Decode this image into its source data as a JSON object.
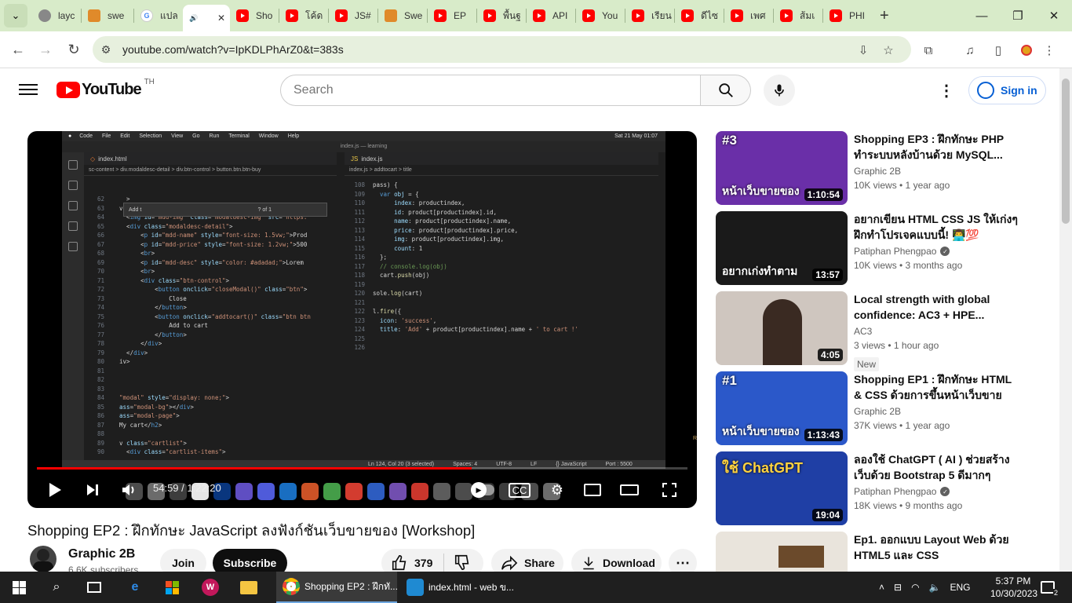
{
  "browser": {
    "tabs": [
      {
        "label": "layc",
        "icon": "globe-icon"
      },
      {
        "label": "swe",
        "icon": "swe-icon"
      },
      {
        "label": "แปล",
        "icon": "google-icon"
      },
      {
        "label": "",
        "icon": "audio-icon",
        "active": true
      },
      {
        "label": "Sho",
        "icon": "youtube-icon"
      },
      {
        "label": "โค้ด",
        "icon": "youtube-icon"
      },
      {
        "label": "JS#",
        "icon": "youtube-icon"
      },
      {
        "label": "Swe",
        "icon": "swe-icon"
      },
      {
        "label": "EP",
        "icon": "youtube-icon"
      },
      {
        "label": "พื้นฐ",
        "icon": "youtube-icon"
      },
      {
        "label": "API",
        "icon": "youtube-icon"
      },
      {
        "label": "You",
        "icon": "youtube-icon"
      },
      {
        "label": "เรียน",
        "icon": "youtube-icon"
      },
      {
        "label": "ดีไซ",
        "icon": "youtube-icon"
      },
      {
        "label": "เพศ",
        "icon": "youtube-icon"
      },
      {
        "label": "ส้มเ",
        "icon": "youtube-icon"
      },
      {
        "label": "PHI",
        "icon": "youtube-icon"
      }
    ],
    "url": "youtube.com/watch?v=IpKDLPhArZ0&t=383s"
  },
  "youtube": {
    "logo_text": "YouTube",
    "country_code": "TH",
    "search_placeholder": "Search",
    "signin_label": "Sign in"
  },
  "video": {
    "title": "Shopping EP2 : ฝึกทักษะ JavaScript ลงฟังก์ชันเว็บขายของ [Workshop]",
    "time_current": "54:59",
    "time_total": "1:22:20",
    "progress": 0.668,
    "channel_name": "Graphic 2B",
    "subscribers": "6.6K subscribers",
    "join_label": "Join",
    "subscribe_label": "Subscribe",
    "likes": "379",
    "share_label": "Share",
    "download_label": "Download"
  },
  "editor": {
    "title": "index.js — learning",
    "left_tab": "index.html",
    "right_tab": "index.js",
    "breadcrumb_left": "sc-content  >  div.modaldesc-detail  >  div.btn-control  >  button.btn.btn-buy",
    "breadcrumb_right": "index.js  >  addtocart  >  title",
    "find_text": "Add t",
    "find_result": "? of 1",
    "status": [
      "Ln 124, Col 20 (3 selected)",
      "Spaces: 4",
      "UTF-8",
      "LF",
      "{} JavaScript",
      "Port : 5500"
    ],
    "mac_menu": [
      "Code",
      "File",
      "Edit",
      "Selection",
      "View",
      "Go",
      "Run",
      "Terminal",
      "Window",
      "Help"
    ],
    "mac_clock": "Sat 21 May  01:07"
  },
  "recommendations": [
    {
      "title": "Shopping EP3 : ฝึกทักษะ PHP ทำระบบหลังบ้านด้วย MySQL...",
      "channel": "Graphic 2B",
      "verified": false,
      "meta": "10K views • 1 year ago",
      "duration": "1:10:54",
      "thumb_text": "หน้าเว็บขายของ",
      "thumb_tag": "#3",
      "thumb_color": "#6a2fa8"
    },
    {
      "title": "อยากเขียน HTML CSS JS ให้เก่งๆ ฝึกทำโปรเจคแบบนี้! 👨‍💻💯",
      "channel": "Patiphan Phengpao",
      "verified": true,
      "meta": "10K views • 3 months ago",
      "duration": "13:57",
      "thumb_text": "อยากเก่งทำตาม",
      "thumb_tag": "",
      "thumb_color": "#1a1a1a"
    },
    {
      "title": "Local strength with global confidence: AC3 + HPE...",
      "channel": "AC3",
      "verified": false,
      "meta": "3 views • 1 hour ago",
      "duration": "4:05",
      "badge": "New",
      "thumb_text": "",
      "thumb_tag": "",
      "thumb_color": "#cfc6bf"
    },
    {
      "title": "Shopping EP1 : ฝึกทักษะ HTML & CSS ด้วยการขึ้นหน้าเว็บขายขอ...",
      "channel": "Graphic 2B",
      "verified": false,
      "meta": "37K views • 1 year ago",
      "duration": "1:13:43",
      "thumb_text": "หน้าเว็บขายของ",
      "thumb_tag": "#1",
      "thumb_color": "#2b58c9"
    },
    {
      "title": "ลองใช้ ChatGPT ( AI ) ช่วยสร้างเว็บด้วย Bootstrap 5 ดีมากๆ งาน...",
      "channel": "Patiphan Phengpao",
      "verified": true,
      "meta": "18K views • 9 months ago",
      "duration": "19:04",
      "thumb_text": "ใช้ ChatGPT",
      "thumb_tag": "",
      "thumb_color": "#1f3fa5"
    },
    {
      "title": "Ep1. ออกแบบ Layout Web ด้วย HTML5 และ CSS",
      "channel": "",
      "verified": false,
      "meta": "",
      "duration": "",
      "thumb_text": "",
      "thumb_tag": "",
      "thumb_color": "#e9e4dc"
    }
  ],
  "taskbar": {
    "apps": [
      {
        "label": "Shopping EP2 : ฝึกทั...",
        "icon": "chrome-icon",
        "active": true
      },
      {
        "label": "index.html - web ข...",
        "icon": "vscode-icon",
        "active": false
      }
    ],
    "language": "ENG",
    "time": "5:37 PM",
    "date": "10/30/2023",
    "notifications": "2"
  }
}
